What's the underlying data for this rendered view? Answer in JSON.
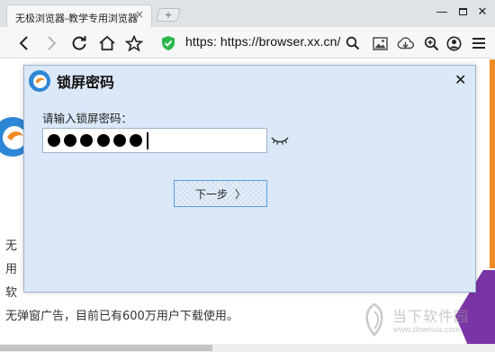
{
  "browser": {
    "tab_title": "无极浏览器-教学专用浏览器",
    "tab_close": "×",
    "new_tab_symbol": "+",
    "url": "https: https://browser.xx.cn/",
    "window_controls": {
      "minimize": "—",
      "close": "✕"
    },
    "toolbar_icons": [
      "back-icon",
      "forward-icon",
      "reload-icon",
      "home-icon",
      "star-icon",
      "shield-icon",
      "search-icon",
      "image-icon",
      "download-icon",
      "zoom-icon",
      "account-icon",
      "menu-icon"
    ]
  },
  "page": {
    "lines": [
      "无",
      "用",
      "软",
      "无弹窗广告，目前已有600万用户下载使用。"
    ],
    "watermark_text": "当下软件园",
    "watermark_url": "www.downxia.com"
  },
  "dialog": {
    "title": "锁屏密码",
    "close_symbol": "✕",
    "password_label": "请输入锁屏密码：",
    "password_dot_count": 6,
    "next_button": "下一步",
    "next_chevron": "〉"
  },
  "colors": {
    "dialog_bg": "#dbe8f8",
    "button_border": "#5a9ee2",
    "shield_green": "#2db84d",
    "orange_accent": "#f08a24",
    "purple_accent": "#7b34a6"
  }
}
